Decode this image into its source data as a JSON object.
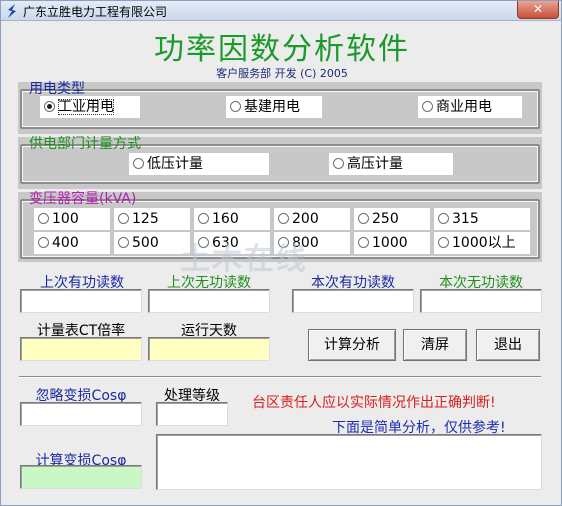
{
  "window": {
    "title": "广东立胜电力工程有限公司",
    "close_label": "✕"
  },
  "header": {
    "title": "功率因数分析软件",
    "subtitle": "客户服务部 开发 (C) 2005"
  },
  "usage_type": {
    "legend": "用电类型",
    "options": [
      "工业用电",
      "基建用电",
      "商业用电"
    ],
    "selected": "工业用电"
  },
  "metering": {
    "legend": "供电部门计量方式",
    "options": [
      "低压计量",
      "高压计量"
    ]
  },
  "transformer": {
    "legend": "变压器容量(kVA)",
    "options": [
      "100",
      "125",
      "160",
      "200",
      "250",
      "315",
      "400",
      "500",
      "630",
      "800",
      "1000",
      "1000以上"
    ]
  },
  "readings": {
    "last_active": "上次有功读数",
    "last_reactive": "上次无功读数",
    "current_active": "本次有功读数",
    "current_reactive": "本次无功读数",
    "ct_ratio": "计量表CT倍率",
    "run_days": "运行天数"
  },
  "buttons": {
    "calculate": "计算分析",
    "clear": "清屏",
    "exit": "退出"
  },
  "loss": {
    "ignore_label": "忽略变损Cosφ",
    "level_label": "处理等级",
    "computed_label": "计算变损Cosφ"
  },
  "notices": {
    "warning": "台区责任人应以实际情况作出正确判断!",
    "info": "下面是简单分析，仅供参考!"
  },
  "watermark": "土木在线",
  "colors": {
    "title_green": "#1a9a2b",
    "legend_blue": "#1a2aa0",
    "legend_green": "#1f8f1f",
    "legend_magenta": "#b01fb0",
    "warning_red": "#d81e1e",
    "info_blue": "#1e2db0",
    "input_yellow": "#ffffc2",
    "input_green": "#c9f7c6"
  }
}
